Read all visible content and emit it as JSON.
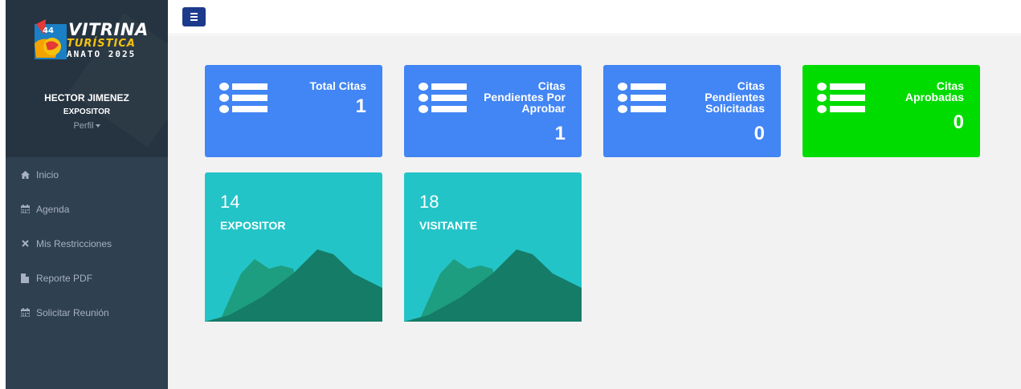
{
  "logo": {
    "badge_number": "44",
    "title": "VITRINA",
    "subtitle": "TURÍSTICA",
    "line3": "ANATO 2025"
  },
  "user": {
    "name": "HECTOR JIMENEZ",
    "role": "EXPOSITOR",
    "profile_label": "Perfil"
  },
  "nav": [
    {
      "label": "Inicio",
      "icon": "home-icon"
    },
    {
      "label": "Agenda",
      "icon": "calendar-icon"
    },
    {
      "label": "Mis Restricciones",
      "icon": "close-icon"
    },
    {
      "label": "Reporte PDF",
      "icon": "file-icon"
    },
    {
      "label": "Solicitar Reunión",
      "icon": "calendar-icon"
    }
  ],
  "summary_cards": [
    {
      "title": "Total Citas",
      "value": "1",
      "color": "#4285f4"
    },
    {
      "title": "Citas Pendientes Por Aprobar",
      "value": "1",
      "color": "#4285f4"
    },
    {
      "title": "Citas Pendientes Solicitadas",
      "value": "0",
      "color": "#4285f4"
    },
    {
      "title": "Citas Aprobadas",
      "value": "0",
      "color": "#00dc00"
    }
  ],
  "stat_cards": [
    {
      "number": "14",
      "label": "EXPOSITOR"
    },
    {
      "number": "18",
      "label": "VISITANTE"
    }
  ],
  "colors": {
    "sidebar": "#2f4050",
    "accent_blue": "#4285f4",
    "accent_green": "#00dc00",
    "teal": "#23c4c8",
    "menu_button": "#1c3a8c"
  }
}
